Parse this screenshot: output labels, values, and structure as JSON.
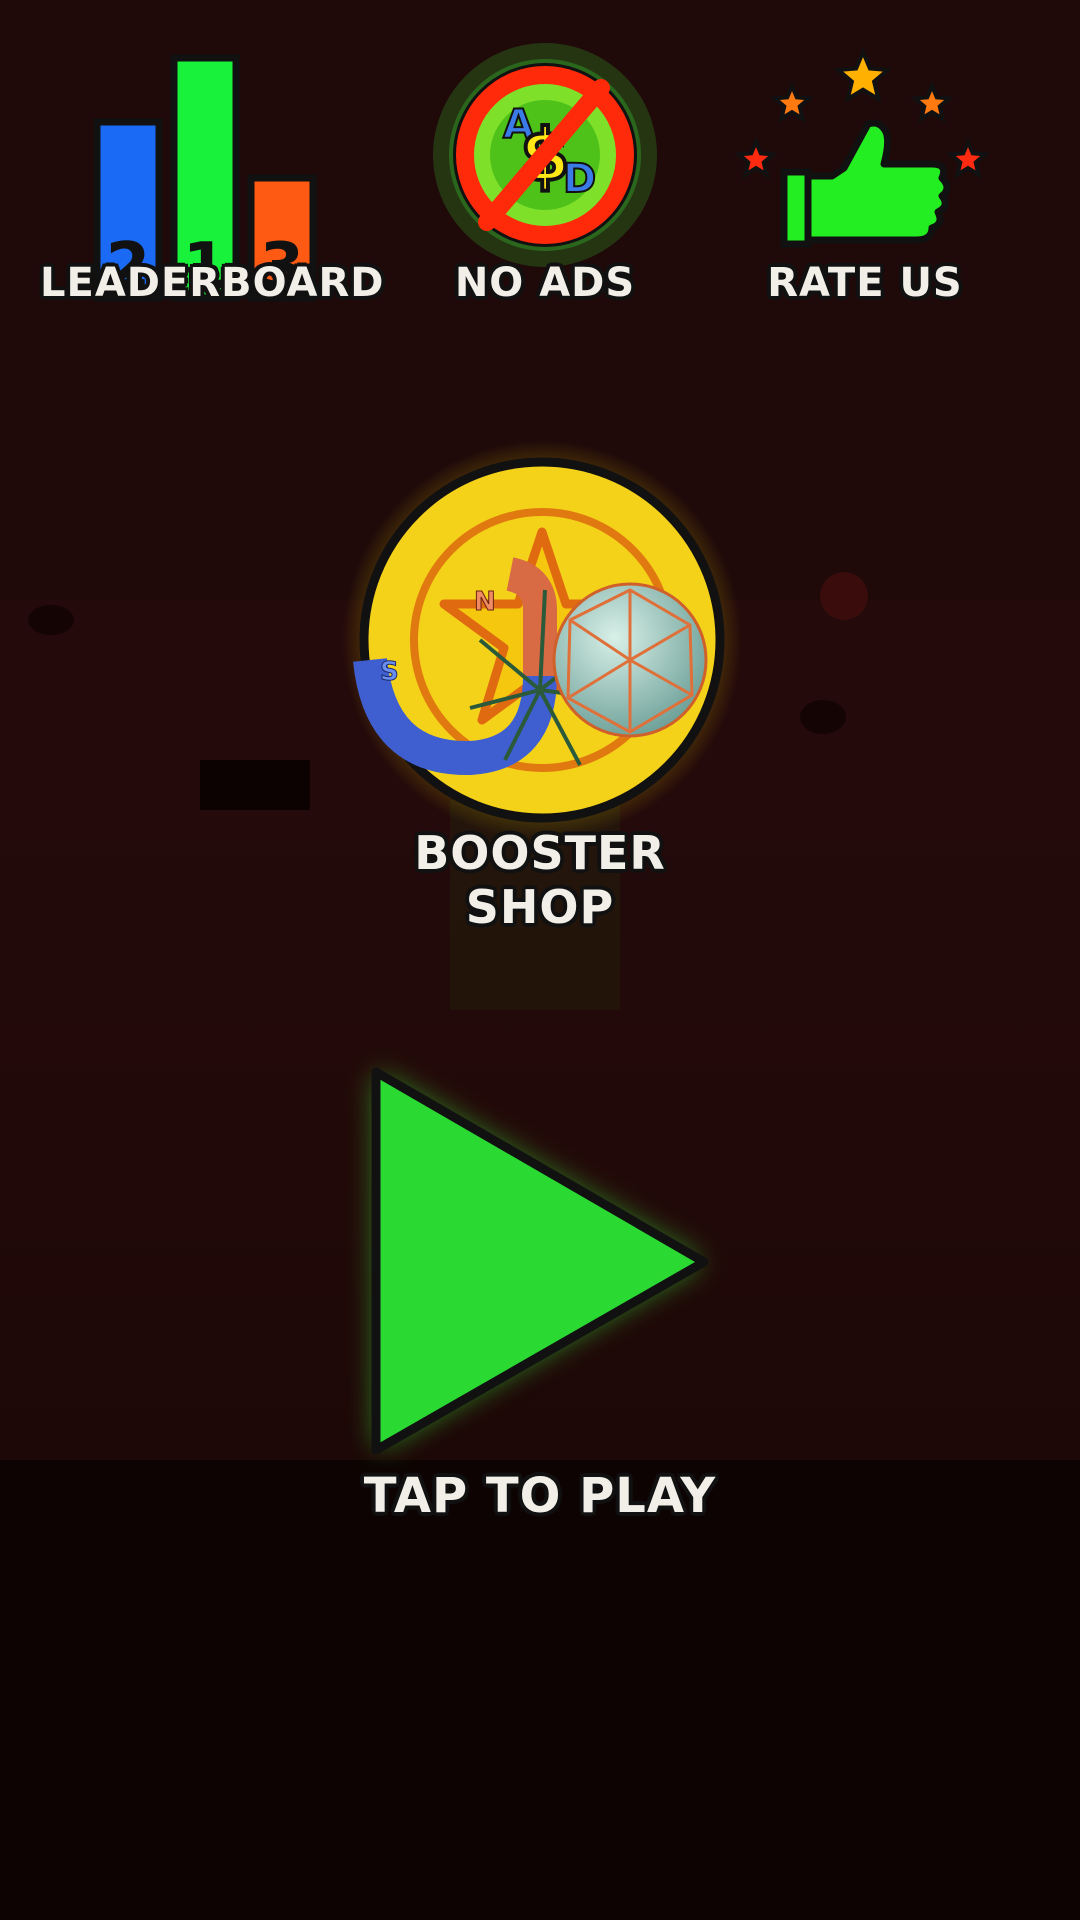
{
  "menu": {
    "leaderboard": {
      "label": "LEADERBOARD",
      "bars": [
        {
          "rank": "2",
          "color": "#1a6af5"
        },
        {
          "rank": "1",
          "color": "#19f23a"
        },
        {
          "rank": "3",
          "color": "#ff5a14"
        }
      ]
    },
    "no_ads": {
      "label": "NO ADS",
      "icon_letters": {
        "a": "A",
        "dollar": "$",
        "d": "D"
      }
    },
    "rate_us": {
      "label": "RATE US"
    }
  },
  "booster_shop": {
    "label": "BOOSTER SHOP",
    "magnet_n": "N",
    "magnet_s": "S"
  },
  "play": {
    "label": "TAP TO PLAY"
  },
  "colors": {
    "play_green": "#2bd933",
    "glow_green": "#3dff3d",
    "coin_yellow": "#f5d21a",
    "ban_red": "#ff2a0a",
    "thumb_green": "#22ee22",
    "text_light": "#f2efe8"
  }
}
